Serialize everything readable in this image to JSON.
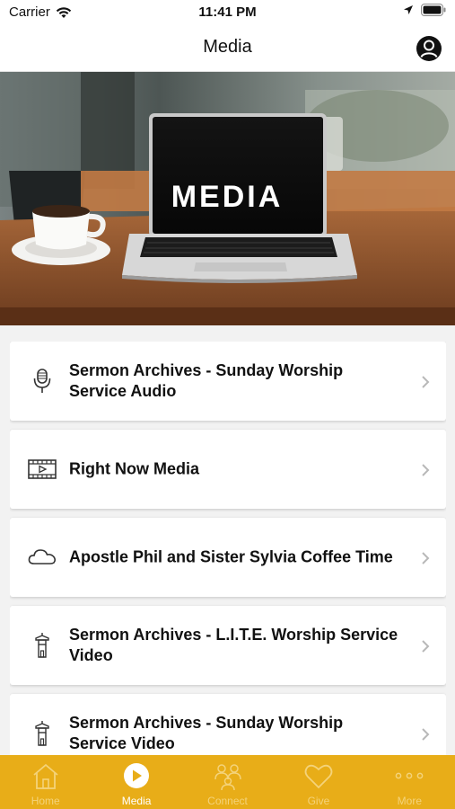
{
  "status": {
    "carrier": "Carrier",
    "time": "11:41 PM"
  },
  "header": {
    "title": "Media"
  },
  "hero": {
    "banner_text": "MEDIA"
  },
  "items": [
    {
      "label": "Sermon Archives - Sunday Worship Service Audio",
      "icon": "microphone-icon"
    },
    {
      "label": "Right Now Media",
      "icon": "film-icon"
    },
    {
      "label": "Apostle Phil and Sister Sylvia Coffee Time",
      "icon": "cloud-icon"
    },
    {
      "label": "Sermon Archives - L.I.T.E.  Worship Service Video",
      "icon": "tower-icon"
    },
    {
      "label": "Sermon Archives - Sunday Worship Service Video",
      "icon": "tower-icon"
    }
  ],
  "tabs": [
    {
      "label": "Home",
      "icon": "home-icon",
      "active": false
    },
    {
      "label": "Media",
      "icon": "play-icon",
      "active": true
    },
    {
      "label": "Connect",
      "icon": "people-icon",
      "active": false
    },
    {
      "label": "Give",
      "icon": "heart-icon",
      "active": false
    },
    {
      "label": "More",
      "icon": "more-icon",
      "active": false
    }
  ],
  "colors": {
    "accent": "#E8AD18",
    "tab_inactive": "#F4D37A",
    "tab_active": "#FFFFFF"
  }
}
